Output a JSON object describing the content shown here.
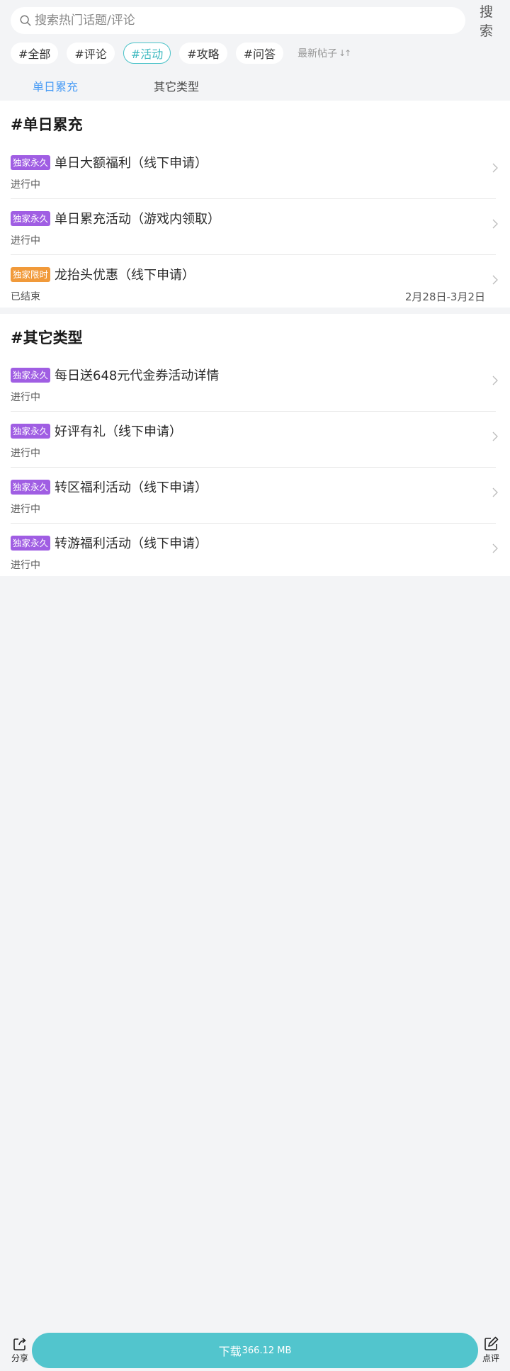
{
  "search": {
    "placeholder": "搜索热门话题/评论",
    "button_label": "搜索"
  },
  "chips": [
    {
      "label": "#全部",
      "active": false
    },
    {
      "label": "#评论",
      "active": false
    },
    {
      "label": "#活动",
      "active": true
    },
    {
      "label": "#攻略",
      "active": false
    },
    {
      "label": "#问答",
      "active": false
    }
  ],
  "sort_label": "最新帖子",
  "category_tabs": [
    {
      "label": "单日累充",
      "active": true
    },
    {
      "label": "其它类型",
      "active": false
    }
  ],
  "sections": [
    {
      "title": "#单日累充",
      "items": [
        {
          "badge": "独家永久",
          "badge_type": "perm",
          "title": "单日大额福利（线下申请）",
          "status": "进行中",
          "date": ""
        },
        {
          "badge": "独家永久",
          "badge_type": "perm",
          "title": "单日累充活动（游戏内领取）",
          "status": "进行中",
          "date": ""
        },
        {
          "badge": "独家限时",
          "badge_type": "limited",
          "title": "龙抬头优惠（线下申请）",
          "status": "已结束",
          "date": "2月28日-3月2日"
        }
      ]
    },
    {
      "title": "#其它类型",
      "items": [
        {
          "badge": "独家永久",
          "badge_type": "perm",
          "title": "每日送648元代金券活动详情",
          "status": "进行中",
          "date": ""
        },
        {
          "badge": "独家永久",
          "badge_type": "perm",
          "title": "好评有礼（线下申请）",
          "status": "进行中",
          "date": ""
        },
        {
          "badge": "独家永久",
          "badge_type": "perm",
          "title": "转区福利活动（线下申请）",
          "status": "进行中",
          "date": ""
        },
        {
          "badge": "独家永久",
          "badge_type": "perm",
          "title": "转游福利活动（线下申请）",
          "status": "进行中",
          "date": ""
        }
      ]
    }
  ],
  "bottom_bar": {
    "share_label": "分享",
    "download_label": "下载",
    "download_size": "366.12 MB",
    "review_label": "点评"
  },
  "colors": {
    "accent_teal": "#52c5cd",
    "tab_active_blue": "#4a9cf5",
    "badge_permanent": "#a05ee3",
    "badge_limited": "#f19a3a"
  }
}
